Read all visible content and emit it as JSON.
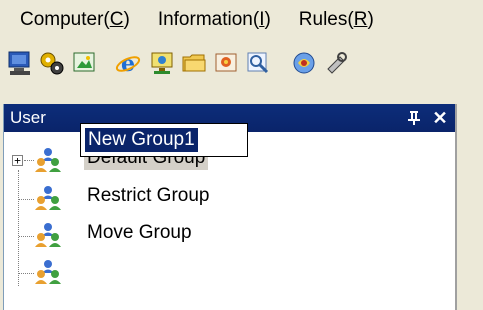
{
  "menu": [
    {
      "label": "Computer(",
      "mnemonic": "C",
      "suffix": ")"
    },
    {
      "label": "Information(",
      "mnemonic": "I",
      "suffix": ")"
    },
    {
      "label": "Rules(",
      "mnemonic": "R",
      "suffix": ")"
    }
  ],
  "toolbar": {
    "icons": [
      "computer-icon",
      "gears-icon",
      "picture-icon",
      "internet-explorer-icon",
      "network-monitor-icon",
      "folder-icon",
      "media-icon",
      "search-icon",
      "software-icon",
      "tools-icon"
    ]
  },
  "pane": {
    "title": "User",
    "pin_glyph": "q",
    "close_glyph": "✕"
  },
  "tree": {
    "expander_glyph": "+",
    "items": [
      {
        "label": "Default Group",
        "icon": "user-group-icon"
      },
      {
        "label": "Restrict Group",
        "icon": "user-group-icon"
      },
      {
        "label": "Move Group",
        "icon": "user-group-icon"
      },
      {
        "label": "New Group1",
        "icon": "user-group-icon"
      }
    ]
  },
  "colors": {
    "header_bg": "#0a246a",
    "selection_bg": "#0a246a",
    "window_bg": "#ece9d8"
  }
}
